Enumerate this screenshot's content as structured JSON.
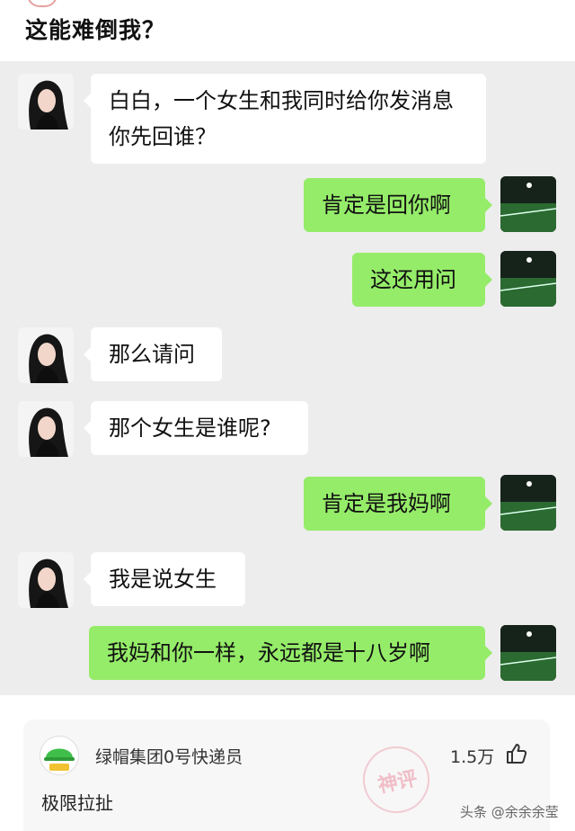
{
  "header": {
    "title": "这能难倒我？"
  },
  "messages": [
    {
      "side": "left",
      "text": "白白，一个女生和我同时给你发消息你先回谁？"
    },
    {
      "side": "right",
      "text": "肯定是回你啊"
    },
    {
      "side": "right",
      "text": "这还用问"
    },
    {
      "side": "left",
      "text": "那么请问"
    },
    {
      "side": "left",
      "text": "那个女生是谁呢?"
    },
    {
      "side": "right",
      "text": "肯定是我妈啊"
    },
    {
      "side": "left",
      "text": "我是说女生"
    },
    {
      "side": "right",
      "text": "我妈和你一样，永远都是十八岁啊"
    }
  ],
  "comment": {
    "username": "绿帽集团0号快递员",
    "likes": "1.5万",
    "text": "极限拉扯",
    "stamp": "神评"
  },
  "watermark": "头条 @余余余莹",
  "colors": {
    "chat_bg": "#ededed",
    "sent_bubble": "#95ec69",
    "received_bubble": "#ffffff"
  },
  "icons": {
    "like": "thumbs-up-icon"
  }
}
